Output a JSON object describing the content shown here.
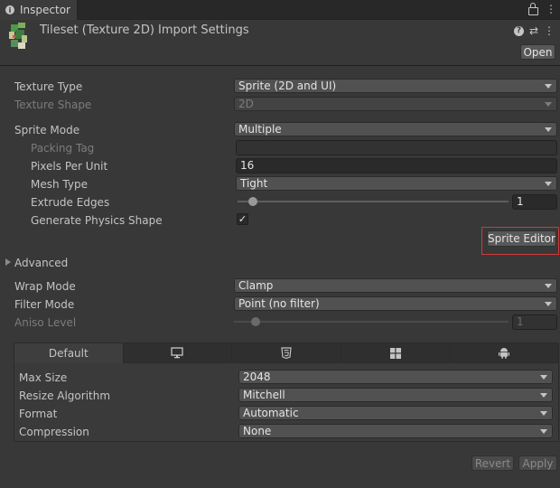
{
  "window": {
    "tab_label": "Inspector"
  },
  "header": {
    "title": "Tileset (Texture 2D) Import Settings",
    "open_label": "Open"
  },
  "settings": {
    "texture_type": {
      "label": "Texture Type",
      "value": "Sprite (2D and UI)"
    },
    "texture_shape": {
      "label": "Texture Shape",
      "value": "2D"
    },
    "sprite_mode": {
      "label": "Sprite Mode",
      "value": "Multiple"
    },
    "packing_tag": {
      "label": "Packing Tag",
      "value": ""
    },
    "pixels_per_unit": {
      "label": "Pixels Per Unit",
      "value": "16"
    },
    "mesh_type": {
      "label": "Mesh Type",
      "value": "Tight"
    },
    "extrude_edges": {
      "label": "Extrude Edges",
      "value": "1",
      "slider_fraction": 0.03
    },
    "generate_physics_shape": {
      "label": "Generate Physics Shape",
      "checked": true,
      "check_glyph": "✓"
    },
    "sprite_editor_label": "Sprite Editor",
    "advanced_label": "Advanced",
    "wrap_mode": {
      "label": "Wrap Mode",
      "value": "Clamp"
    },
    "filter_mode": {
      "label": "Filter Mode",
      "value": "Point (no filter)"
    },
    "aniso_level": {
      "label": "Aniso Level",
      "value": "1",
      "slider_fraction": 0.08
    }
  },
  "platform": {
    "tabs": [
      {
        "label": "Default",
        "icon": ""
      },
      {
        "label": "",
        "icon": "monitor-icon"
      },
      {
        "label": "",
        "icon": "html5-icon"
      },
      {
        "label": "",
        "icon": "windows-icon"
      },
      {
        "label": "",
        "icon": "android-icon"
      }
    ],
    "max_size": {
      "label": "Max Size",
      "value": "2048"
    },
    "resize_algorithm": {
      "label": "Resize Algorithm",
      "value": "Mitchell"
    },
    "format": {
      "label": "Format",
      "value": "Automatic"
    },
    "compression": {
      "label": "Compression",
      "value": "None"
    }
  },
  "footer": {
    "revert_label": "Revert",
    "apply_label": "Apply"
  },
  "colors": {
    "highlight": "#d03a3a",
    "background": "#383838"
  }
}
